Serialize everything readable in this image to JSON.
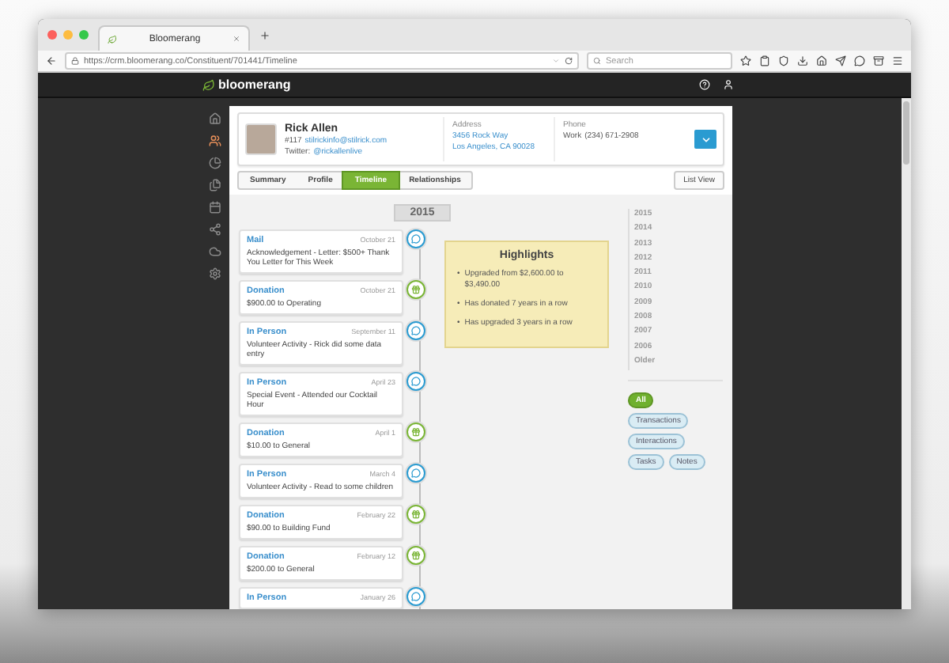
{
  "browser": {
    "tab_title": "Bloomerang",
    "url": "https://crm.bloomerang.co/Constituent/701441/Timeline",
    "search_placeholder": "Search"
  },
  "app": {
    "brand": "bloomerang"
  },
  "nav_items": [
    {
      "kind": "home",
      "selected": false
    },
    {
      "kind": "people",
      "selected": true
    },
    {
      "kind": "chart",
      "selected": false
    },
    {
      "kind": "files",
      "selected": false
    },
    {
      "kind": "calendar",
      "selected": false
    },
    {
      "kind": "share",
      "selected": false
    },
    {
      "kind": "cloud",
      "selected": false
    },
    {
      "kind": "settings",
      "selected": false
    }
  ],
  "constituent": {
    "name": "Rick Allen",
    "number": "#117",
    "email": "stilrickinfo@stilrick.com",
    "twitter_label": "Twitter:",
    "twitter": "@rickallenlive",
    "address_label": "Address",
    "address_lines": [
      "3456 Rock Way",
      "Los Angeles, CA 90028"
    ],
    "phone_label": "Phone",
    "phone_type": "Work",
    "phone": "(234) 671-2908"
  },
  "tabs": [
    {
      "label": "Summary",
      "selected": false
    },
    {
      "label": "Profile",
      "selected": false
    },
    {
      "label": "Timeline",
      "selected": true
    },
    {
      "label": "Relationships",
      "selected": false
    }
  ],
  "list_view": "List View",
  "year": "2015",
  "events": [
    {
      "kind": "interaction",
      "title": "Mail",
      "date": "October 21",
      "text": "Acknowledgement - Letter: $500+ Thank You Letter for This Week"
    },
    {
      "kind": "donation",
      "title": "Donation",
      "date": "October 21",
      "text": "$900.00 to Operating"
    },
    {
      "kind": "interaction",
      "title": "In Person",
      "date": "September 11",
      "text": "Volunteer Activity - Rick did some data entry"
    },
    {
      "kind": "interaction",
      "title": "In Person",
      "date": "April 23",
      "text": "Special Event - Attended our Cocktail Hour"
    },
    {
      "kind": "donation",
      "title": "Donation",
      "date": "April 1",
      "text": "$10.00 to General"
    },
    {
      "kind": "interaction",
      "title": "In Person",
      "date": "March 4",
      "text": "Volunteer Activity - Read to some children"
    },
    {
      "kind": "donation",
      "title": "Donation",
      "date": "February 22",
      "text": "$90.00 to Building Fund"
    },
    {
      "kind": "donation",
      "title": "Donation",
      "date": "February 12",
      "text": "$200.00 to General"
    },
    {
      "kind": "interaction",
      "title": "In Person",
      "date": "January 26"
    }
  ],
  "highlights": {
    "title": "Highlights",
    "bullet": "•",
    "items": [
      "Upgraded from $2,600.00 to $3,490.00",
      "Has donated 7 years in a row",
      "Has upgraded 3 years in a row"
    ]
  },
  "years": [
    "2015",
    "2014",
    "2013",
    "2012",
    "2011",
    "2010",
    "2009",
    "2008",
    "2007",
    "2006",
    "Older"
  ],
  "filters": [
    {
      "label": "All",
      "selected": true
    },
    {
      "label": "Transactions",
      "selected": false
    },
    {
      "label": "Interactions",
      "selected": false
    },
    {
      "label": "Tasks",
      "selected": false
    },
    {
      "label": "Notes",
      "selected": false
    }
  ]
}
